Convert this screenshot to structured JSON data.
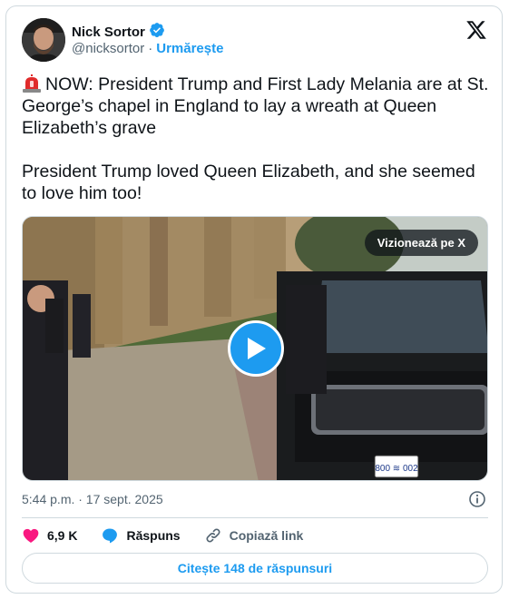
{
  "author": {
    "name": "Nick Sortor",
    "handle": "@nicksortor",
    "separator": "·",
    "follow_label": "Urmărește"
  },
  "tweet": {
    "text": "NOW: President Trump and First Lady Melania are at St. George’s chapel in England to lay a wreath at Queen Elizabeth’s grave\n\nPresident Trump loved Queen Elizabeth, and she seemed to love him too!",
    "timestamp": "5:44 p.m. · 17 sept. 2025"
  },
  "media": {
    "watch_label": "Vizionează pe X",
    "plate_text": "800 ≋ 002"
  },
  "actions": {
    "likes": "6,9 K",
    "reply_label": "Răspuns",
    "copy_label": "Copiază link"
  },
  "read_replies_label": "Citește 148 de răspunsuri",
  "colors": {
    "accent": "#1d9bf0",
    "like": "#f91880",
    "text": "#0f1419",
    "muted": "#536471",
    "border": "#cfd9de"
  }
}
